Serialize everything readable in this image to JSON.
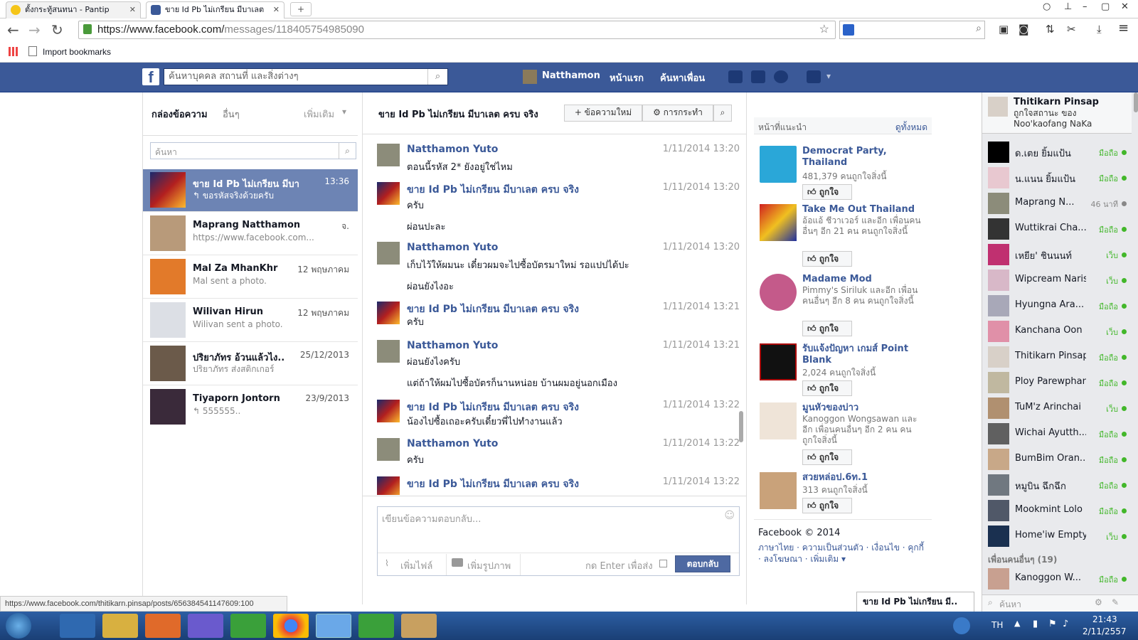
{
  "browser": {
    "tabs": [
      {
        "title": "ตั้งกระทู้สนทนา - Pantip"
      },
      {
        "title": "ขาย Id Pb ไม่เกรียน มีบาเลต"
      }
    ],
    "url_host": "https://www.facebook.com/",
    "url_path": "messages/118405754985090",
    "bookmark_label": "Import bookmarks",
    "status_url": "https://www.facebook.com/thitikarn.pinsap/posts/656384541147609:100"
  },
  "fb_header": {
    "logo": "f",
    "search_placeholder": "ค้นหาบุคคล สถานที่ และสิ่งต่างๆ",
    "user_name": "Natthamon",
    "home": "หน้าแรก",
    "find_friends": "ค้นหาเพื่อน"
  },
  "inbox": {
    "title": "กล่องข้อความ",
    "other": "อื่นๆ",
    "more": "เพิ่มเติม",
    "search_placeholder": "ค้นหา",
    "conversations": [
      {
        "name": "ขาย Id Pb ไม่เกรียน มีบาเล..",
        "date": "13:36",
        "snippet": "↰ ขอรหัสจริงด้วยครับ"
      },
      {
        "name": "Maprang Natthamon Yuto",
        "date": "จ.",
        "snippet": "https://www.facebook.com..."
      },
      {
        "name": "Mal Za MhanKhr",
        "date": "12 พฤษภาคม",
        "snippet": "Mal sent a photo."
      },
      {
        "name": "Wilivan Hirun",
        "date": "12 พฤษภาคม",
        "snippet": "Wilivan sent a photo."
      },
      {
        "name": "ปริยาภัทร อ้วนแล้วไง..",
        "date": "25/12/2013",
        "snippet": "ปริยาภัทร ส่งสติกเกอร์"
      },
      {
        "name": "Tiyaporn Jontorn",
        "date": "23/9/2013",
        "snippet": "↰ 555555.."
      }
    ]
  },
  "thread": {
    "title": "ขาย Id Pb ไม่เกรียน มีบาเลต ครบ จริง",
    "new_message": "+ ข้อความใหม่",
    "actions": "⚙ การกระทำ",
    "messages": [
      {
        "name": "Natthamon Yuto",
        "time": "1/11/2014 13:20",
        "lines": [
          "ตอนนี้รหัส 2* ยังอยู่ใช่ไหม"
        ]
      },
      {
        "name": "ขาย Id Pb ไม่เกรียน มีบาเลต ครบ จริง",
        "time": "1/11/2014 13:20",
        "lines": [
          "ครับ",
          "ผ่อนปะละ"
        ]
      },
      {
        "name": "Natthamon Yuto",
        "time": "1/11/2014 13:20",
        "lines": [
          "เก็บไว้ให้ผมนะ เดี๋ยวผมจะไปซื้อบัตรมาใหม่ รอแปปได้ปะ",
          "ผ่อนยังไงอะ"
        ]
      },
      {
        "name": "ขาย Id Pb ไม่เกรียน มีบาเลต ครบ จริง",
        "time": "1/11/2014 13:21",
        "lines": [
          "ครับ"
        ]
      },
      {
        "name": "Natthamon Yuto",
        "time": "1/11/2014 13:21",
        "lines": [
          "ผ่อนยังไงครับ",
          "แต่ถ้าให้ผมไปซื้อบัตรก็นานหน่อย บ้านผมอยู่นอกเมือง"
        ]
      },
      {
        "name": "ขาย Id Pb ไม่เกรียน มีบาเลต ครบ จริง",
        "time": "1/11/2014 13:22",
        "lines": [
          "น้องไปซื้อเถอะครับเดี๋ยวพี่ไปทำงานแล้ว"
        ]
      },
      {
        "name": "Natthamon Yuto",
        "time": "1/11/2014 13:22",
        "lines": [
          "ครับ"
        ]
      },
      {
        "name": "ขาย Id Pb ไม่เกรียน มีบาเลต ครบ จริง",
        "time": "1/11/2014 13:22",
        "lines": [
          ""
        ]
      }
    ],
    "reply_placeholder": "เขียนข้อความตอบกลับ...",
    "add_file": "เพิ่มไฟล์",
    "add_photo": "เพิ่มรูปภาพ",
    "enter_to_send": "กด Enter เพื่อส่ง",
    "reply_button": "ตอบกลับ"
  },
  "suggested": {
    "title": "หน้าที่แนะนำ",
    "see_all": "ดูทั้งหมด",
    "like_label": "ถูกใจ",
    "pages": [
      {
        "name": "Democrat Party, Thailand",
        "desc": "481,379 คนถูกใจสิ่งนี้"
      },
      {
        "name": "Take Me Out Thailand",
        "desc": "อ้อแอ้ ชีวาเวอร์ และอีก เพื่อนคนอื่นๆ อีก 21 คน คนถูกใจสิ่งนี้"
      },
      {
        "name": "Madame Mod",
        "desc": "Pimmy's Siriluk และอีก เพื่อนคนอื่นๆ อีก 8 คน คนถูกใจสิ่งนี้"
      },
      {
        "name": "รับแจ้งปัญหา เกมส์ Point Blank",
        "desc": "2,024 คนถูกใจสิ่งนี้"
      },
      {
        "name": "มูนหัวของบ่าว",
        "desc": "Kanoggon Wongsawan และอีก เพื่อนคนอื่นๆ อีก 2 คน คนถูกใจสิ่งนี้"
      },
      {
        "name": "สวยหล่อป.6ท.1",
        "desc": "313 คนถูกใจสิ่งนี้"
      }
    ],
    "footer_copy": "Facebook © 2014",
    "footer_links": "ภาษาไทย · ความเป็นส่วนตัว · เงื่อนไข · คุกกี้ · ลงโฆษณา · เพิ่มเติม ▾"
  },
  "chat": {
    "ticker_name": "Thitikarn Pinsap",
    "ticker_text": "ถูกใจสถานะ ของ Noo'kaofang NaKa",
    "friends": [
      {
        "name": "ด.เตย ยิ้มแป้น",
        "status": "มือถือ"
      },
      {
        "name": "น.แนน ยิ้มแป้น",
        "status": "มือถือ"
      },
      {
        "name": "Maprang N...",
        "status": "46 นาที"
      },
      {
        "name": "Wuttikrai Cha...",
        "status": "มือถือ"
      },
      {
        "name": "เหยีย' ชินนนท์",
        "status": "เว็บ"
      },
      {
        "name": "Wipcream Naris...",
        "status": "เว็บ"
      },
      {
        "name": "Hyungna Ara...",
        "status": "มือถือ"
      },
      {
        "name": "Kanchana Oon ...",
        "status": "เว็บ"
      },
      {
        "name": "Thitikarn Pinsap",
        "status": "มือถือ"
      },
      {
        "name": "Ploy Parewphan",
        "status": "มือถือ"
      },
      {
        "name": "TuM'z Arinchai",
        "status": "เว็บ"
      },
      {
        "name": "Wichai Ayutth...",
        "status": "มือถือ"
      },
      {
        "name": "BumBim Oran...",
        "status": "มือถือ"
      },
      {
        "name": "หมูบิน ฉึกฉึก",
        "status": "มือถือ"
      },
      {
        "name": "Mookmint Lolo",
        "status": "มือถือ"
      },
      {
        "name": "Home'iw Empty",
        "status": "เว็บ"
      }
    ],
    "more_friends": "เพื่อนคนอื่นๆ (19)",
    "extra_friend": {
      "name": "Kanoggon W...",
      "status": "มือถือ"
    },
    "search_placeholder": "ค้นหา",
    "docked_tab": "ขาย Id Pb ไม่เกรียน มี.."
  },
  "taskbar": {
    "lang": "TH",
    "time": "21:43",
    "date": "2/11/2557"
  },
  "colors": {
    "fb_blue": "#3b5998",
    "online_green": "#42b72a"
  }
}
